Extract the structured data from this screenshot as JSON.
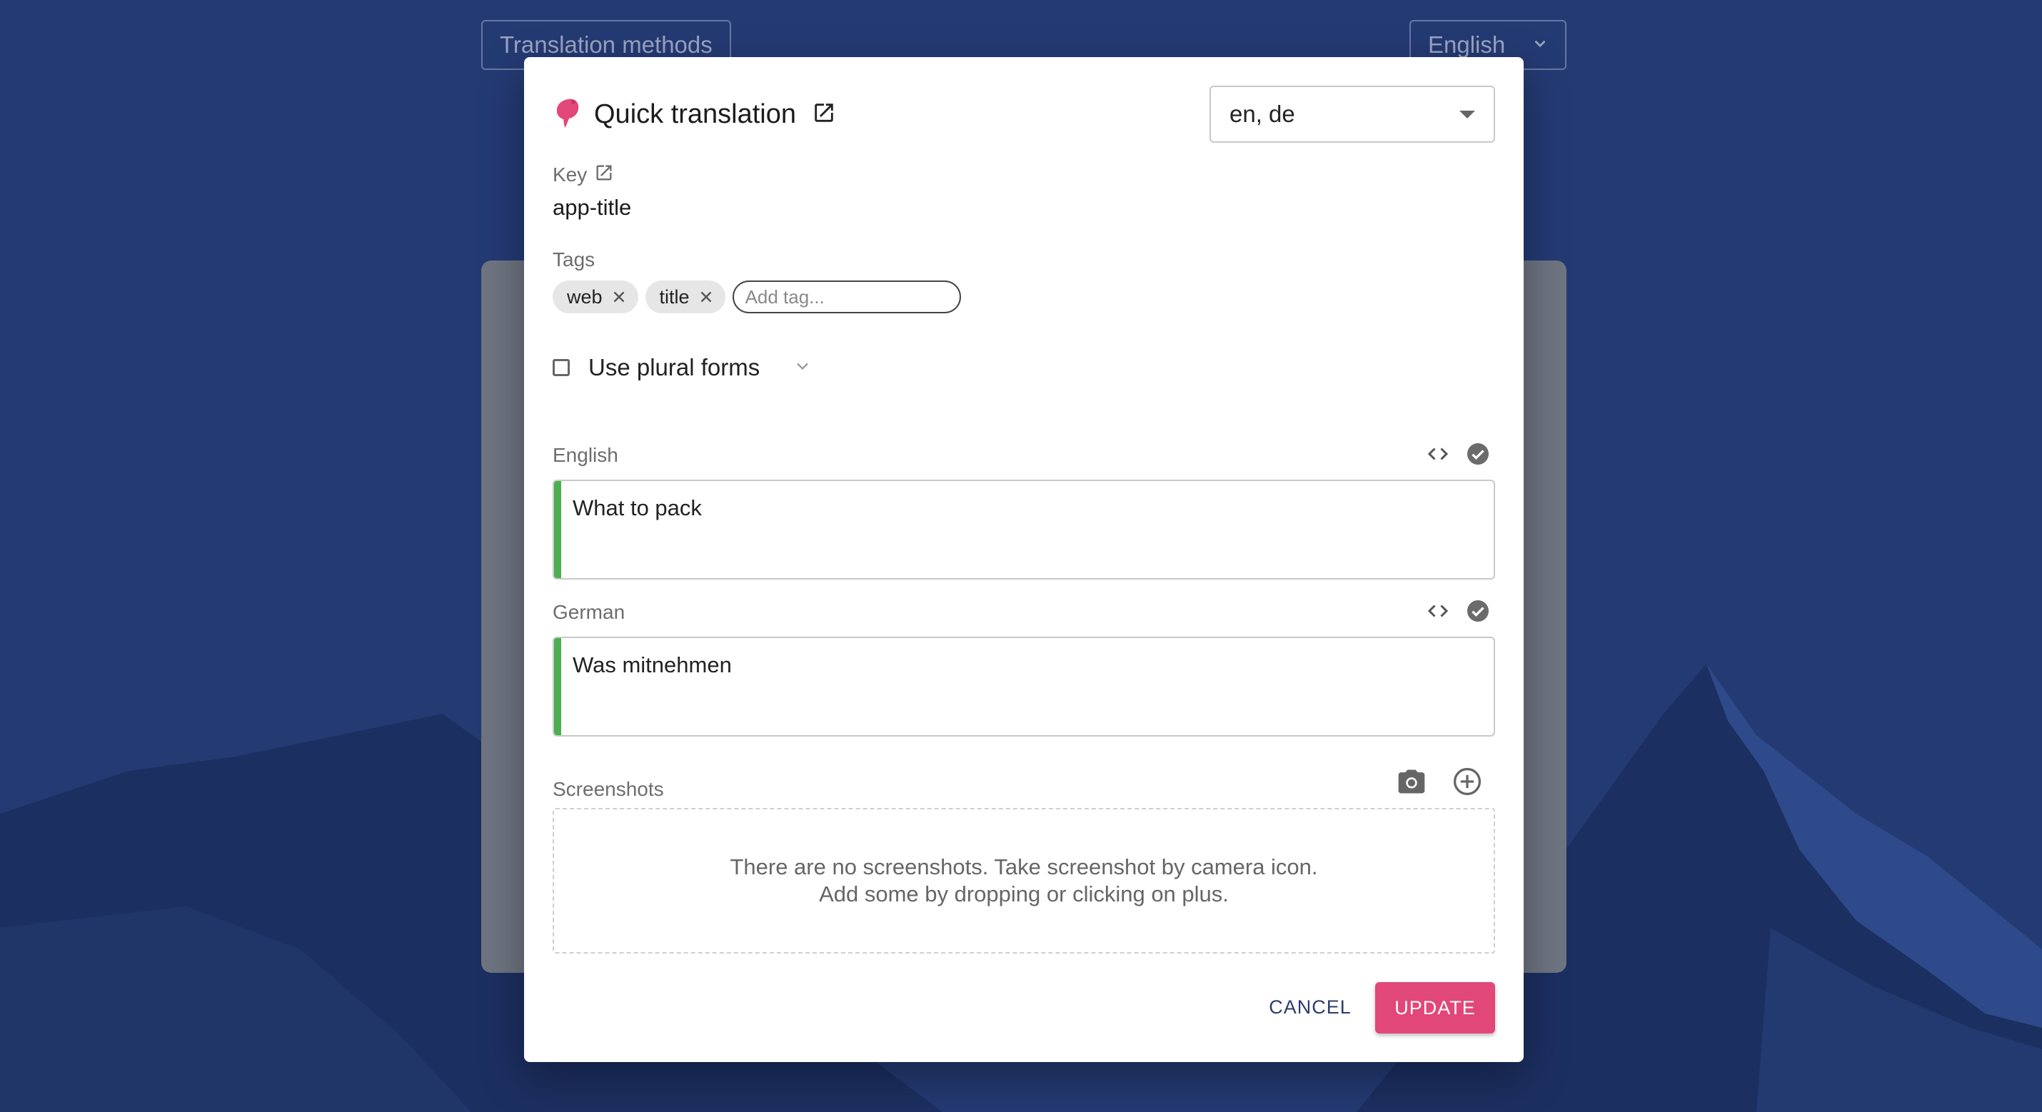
{
  "background": {
    "methods_button": "Translation methods",
    "language_select": "English"
  },
  "dialog": {
    "title": "Quick translation",
    "languages": "en, de",
    "key": {
      "label": "Key",
      "value": "app-title"
    },
    "tags": {
      "label": "Tags",
      "items": [
        "web",
        "title"
      ],
      "placeholder": "Add tag..."
    },
    "plural": {
      "label": "Use plural forms",
      "checked": false
    },
    "translations": [
      {
        "language": "English",
        "text": "What to pack",
        "state_color": "#4caf50"
      },
      {
        "language": "German",
        "text": "Was mitnehmen",
        "state_color": "#4caf50"
      }
    ],
    "screenshots": {
      "label": "Screenshots",
      "empty_line1": "There are no screenshots. Take screenshot by camera icon.",
      "empty_line2": "Add some by dropping or clicking on plus."
    },
    "actions": {
      "cancel": "CANCEL",
      "update": "UPDATE"
    }
  },
  "colors": {
    "background": "#243a73",
    "accent": "#e2477a",
    "translated": "#4caf50"
  }
}
